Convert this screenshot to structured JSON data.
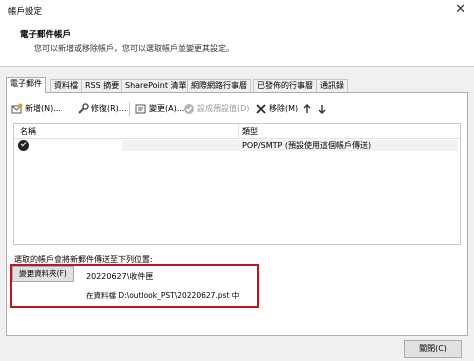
{
  "window": {
    "title": "帳戶設定"
  },
  "header": {
    "heading": "電子郵件帳戶",
    "description": "您可以新增或移除帳戶，您可以選取帳戶並變更其設定。"
  },
  "tabs": [
    {
      "label": "電子郵件",
      "active": true
    },
    {
      "label": "資料檔"
    },
    {
      "label": "RSS 摘要"
    },
    {
      "label": "SharePoint 清單"
    },
    {
      "label": "網際網路行事曆"
    },
    {
      "label": "已發佈的行事曆"
    },
    {
      "label": "通訊錄"
    }
  ],
  "toolbar": {
    "new_label": "新增(N)...",
    "repair_label": "修復(R)...",
    "change_label": "變更(A)...",
    "default_label": "設成預設值(D)",
    "remove_label": "移除(M)"
  },
  "account_list": {
    "col_name": "名稱",
    "col_type": "類型",
    "rows": [
      {
        "name": "",
        "type": "POP/SMTP (預設使用這個帳戶傳送)"
      }
    ]
  },
  "delivery": {
    "label": "選取的帳戶會將新郵件傳送至下列位置:",
    "change_folder_label": "變更資料夾(F)",
    "folder_name": "20220627\\收件匣",
    "folder_path": "在資料檔 D:\\outlook_PST\\20220627.pst 中"
  },
  "footer": {
    "close_label": "關閉(C)"
  },
  "colors": {
    "highlight": "#c0151c"
  }
}
